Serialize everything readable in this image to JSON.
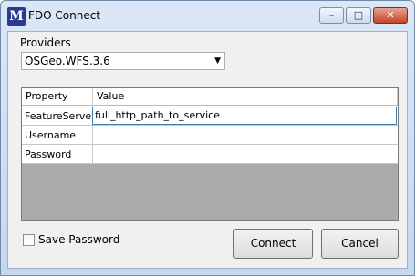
{
  "window": {
    "title": "FDO Connect",
    "app_icon_letter": "M"
  },
  "controls": {
    "minimize_glyph": "–",
    "maximize_glyph": "□",
    "close_glyph": "✕"
  },
  "providers": {
    "label": "Providers",
    "selected": "OSGeo.WFS.3.6",
    "arrow": "▼"
  },
  "grid": {
    "headers": [
      "Property",
      "Value"
    ],
    "rows": [
      {
        "property": "FeatureServer",
        "value": "full_http_path_to_service"
      },
      {
        "property": "Username",
        "value": ""
      },
      {
        "property": "Password",
        "value": ""
      }
    ]
  },
  "save_password": {
    "label": "Save Password",
    "checked": false
  },
  "buttons": {
    "connect": "Connect",
    "cancel": "Cancel"
  }
}
